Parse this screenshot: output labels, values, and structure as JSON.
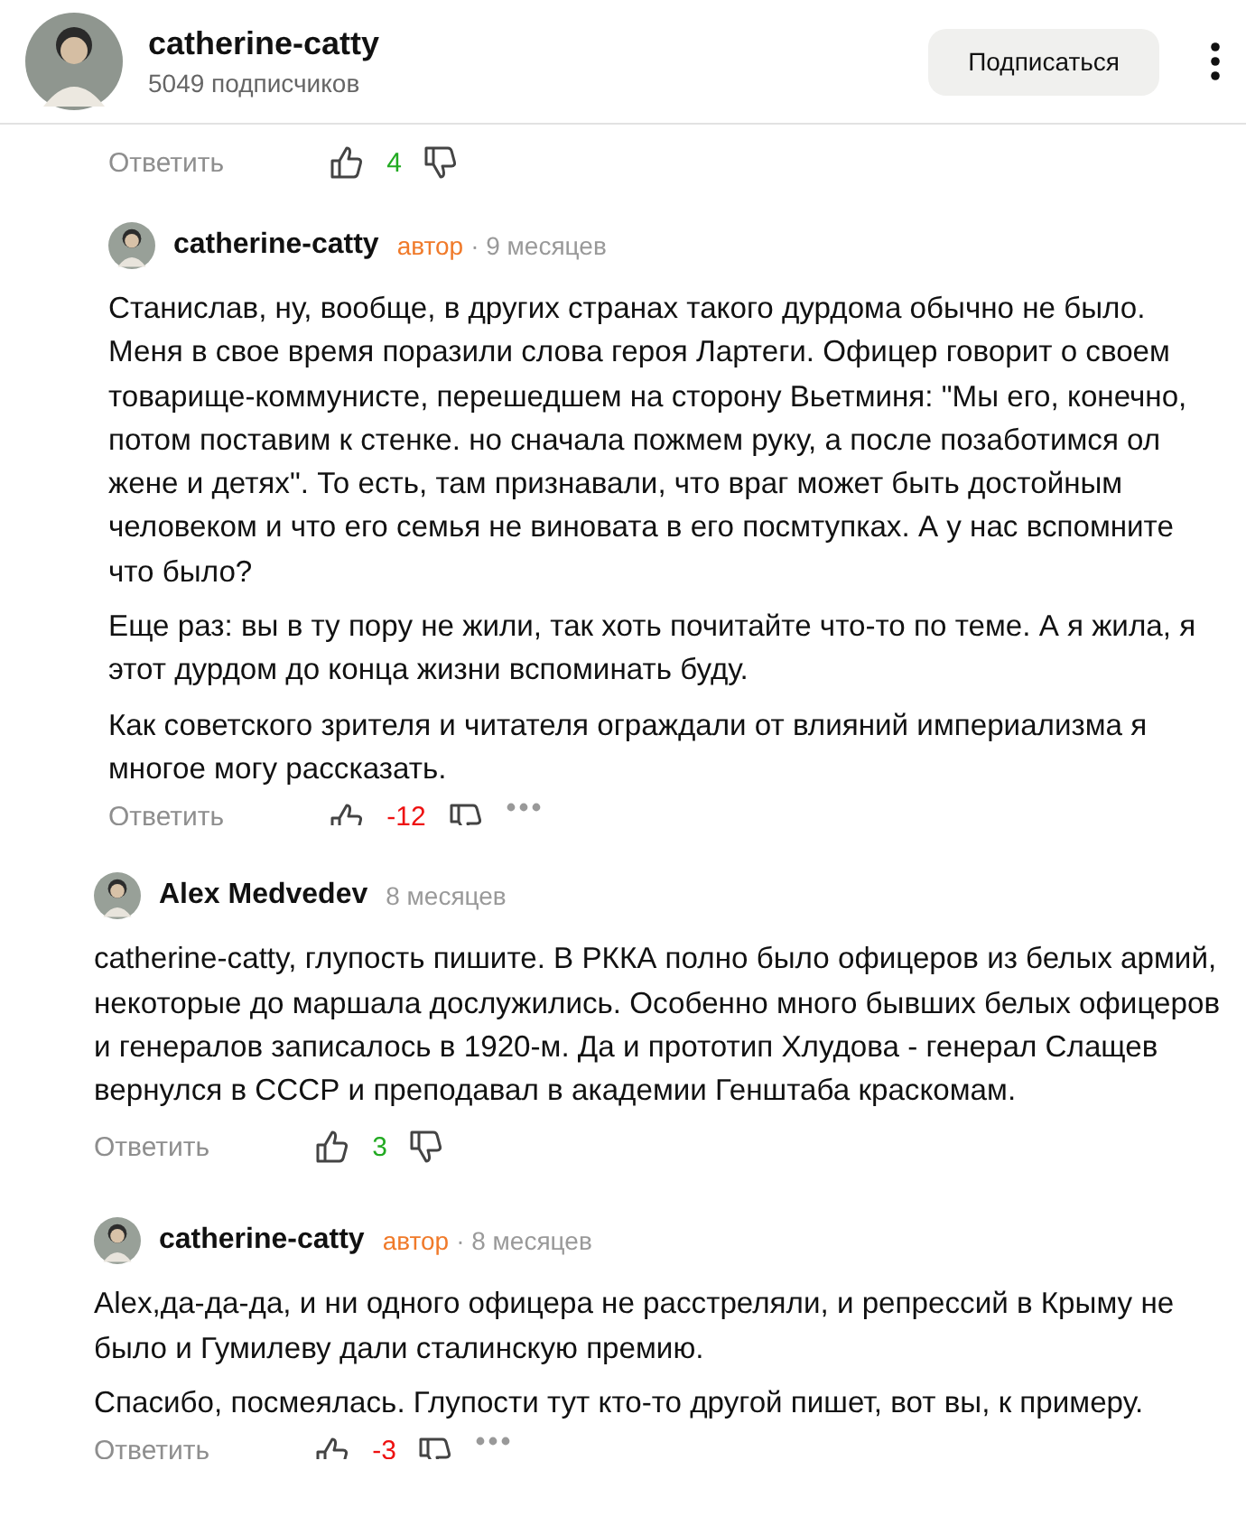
{
  "channel": {
    "name": "catherine-catty",
    "subscribers": "5049 подписчиков",
    "subscribe_button": "Подписаться"
  },
  "top_actions": {
    "reply": "Ответить",
    "rating": "4",
    "kind": "positive",
    "clipped": false
  },
  "comments": [
    {
      "author": "catherine-catty",
      "badge": "автор",
      "time": "· 9 месяцев",
      "indent": true,
      "paragraphs": [
        "Станислав, ну, вообще, в других странах такого дурдома обычно не было. Меня в свое время поразили слова героя Лартеги. Офицер говорит о своем товарище-коммунисте, перешедшем на сторону Вьетминя: \"Мы его, конечно, потом поставим к стенке. но сначала пожмем руку, а после позаботимся ол жене и детях\". То есть, там признавали, что враг может быть достойным человеком и что его семья не виновата в его посмтупках. А у нас вспомните что было?",
        "Еще раз: вы в ту пору не жили, так хоть почитайте что-то по теме. А я жила, я этот дурдом до конца жизни вспоминать буду.",
        "Как советского зрителя и читателя ограждали от влияний империализма я многое могу рассказать."
      ],
      "actions": {
        "reply": "Ответить",
        "rating": "-12",
        "kind": "negative",
        "clipped": true
      }
    },
    {
      "author": "Alex Medvedev",
      "time": "8 месяцев",
      "indent": false,
      "paragraphs": [
        "catherine-catty, глупость пишите. В РККА полно было офицеров из белых армий, некоторые до маршала дослужились. Особенно много бывших белых офицеров и генералов записалось в 1920-м. Да и прототип Хлудова - генерал Слащев вернулся в СССР и преподавал в академии Генштаба краскомам."
      ],
      "actions": {
        "reply": "Ответить",
        "rating": "3",
        "kind": "positive",
        "clipped": false
      }
    },
    {
      "author": "catherine-catty",
      "badge": "автор",
      "time": "· 8 месяцев",
      "indent": false,
      "paragraphs": [
        "Alex,да-да-да, и ни одного офицера не расстреляли, и репрессий в Крыму не было и Гумилеву дали сталинскую премию.",
        "Спасибо, посмеялась. Глупости тут кто-то другой пишет, вот вы, к примеру."
      ],
      "actions": {
        "reply": "Ответить",
        "rating": "-3",
        "kind": "negative",
        "clipped": true
      }
    }
  ]
}
